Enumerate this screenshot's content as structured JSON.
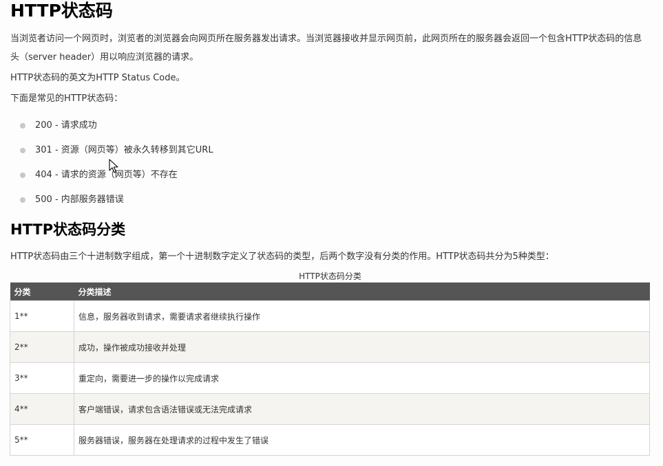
{
  "header": {
    "title": "HTTP状态码"
  },
  "intro": {
    "paragraph1": "当浏览者访问一个网页时，浏览者的浏览器会向网页所在服务器发出请求。当浏览器接收并显示网页前，此网页所在的服务器会返回一个包含HTTP状态码的信息头（server header）用以响应浏览器的请求。",
    "paragraph2": "HTTP状态码的英文为HTTP Status Code。",
    "paragraph3": "下面是常见的HTTP状态码："
  },
  "common_codes": [
    {
      "text": "200 - 请求成功"
    },
    {
      "text": "301 - 资源（网页等）被永久转移到其它URL"
    },
    {
      "text": "404 - 请求的资源（网页等）不存在"
    },
    {
      "text": "500 - 内部服务器错误"
    }
  ],
  "section": {
    "title": "HTTP状态码分类",
    "description": "HTTP状态码由三个十进制数字组成，第一个十进制数字定义了状态码的类型，后两个数字没有分类的作用。HTTP状态码共分为5种类型："
  },
  "table": {
    "caption": "HTTP状态码分类",
    "headers": [
      "分类",
      "分类描述"
    ],
    "rows": [
      {
        "category": "1**",
        "description": "信息，服务器收到请求，需要请求者继续执行操作"
      },
      {
        "category": "2**",
        "description": "成功，操作被成功接收并处理"
      },
      {
        "category": "3**",
        "description": "重定向，需要进一步的操作以完成请求"
      },
      {
        "category": "4**",
        "description": "客户端错误，请求包含语法错误或无法完成请求"
      },
      {
        "category": "5**",
        "description": "服务器错误，服务器在处理请求的过程中发生了错误"
      }
    ]
  },
  "icons": {
    "cursor": "mouse-pointer-icon",
    "bullet": "bullet-dot-icon"
  },
  "colors": {
    "table_header_bg": "#555555",
    "table_row_alt_bg": "#f6f4f0",
    "bullet": "#c8c8c8"
  }
}
